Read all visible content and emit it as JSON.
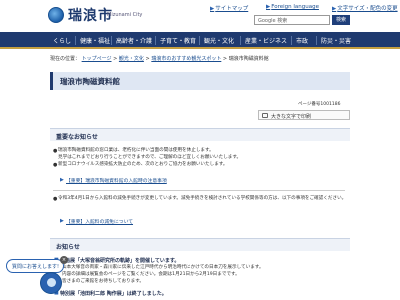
{
  "header": {
    "logo_text": "瑞浪市",
    "logo_sub": "Mizunami City",
    "links": [
      {
        "label": "サイトマップ"
      },
      {
        "label": "Foreign language"
      },
      {
        "label": "文字サイズ・配色の変更"
      }
    ],
    "search_placeholder": "Google 検索",
    "search_button": "検索"
  },
  "gnav": [
    "くらし",
    "健康・福祉",
    "高齢者・介護",
    "子育て・教育",
    "観光・文化",
    "産業・ビジネス",
    "市政",
    "防災・災害"
  ],
  "breadcrumb": {
    "prefix": "現在の位置：",
    "items": [
      "トップページ",
      "観光・文化",
      "瑞浪市のおすすめ観光スポット",
      "瑞浪市陶磁資料館"
    ]
  },
  "page": {
    "title": "瑞浪市陶磁資料館",
    "page_id": "ページ番号1001186",
    "font_size_label": "大きな文字で印刷"
  },
  "notice": {
    "heading": "重要なお知らせ",
    "p1": "瑞浪市陶磁資料館の窓ロ業は、老朽化に伴い当面の間は使用を休止します。",
    "p1b": "見学はこれまでどおり行うことができますので、ご理解のほど宜しくお願いいたします。",
    "p2": "新型コロナウイルス感染拡大防止のため、次のとおりご協力をお願いいたします。",
    "link1": "【重要】瑞浪市陶磁資料館の入館時の注意事項",
    "p3": "令和3年4月1日から入館料の減免手続きが変更しています。減免手続きを検討されている学校関係等の方は、以下の事項をご確認ください。",
    "link2": "【重要】入館料の減免について"
  },
  "news": {
    "heading": "お知らせ",
    "items": [
      {
        "title": "企画展「大塚音翁研究所の軌跡」を開催しています。"
      },
      {
        "title": "特別展「池田利二郎 陶作展」は終了しました。"
      }
    ],
    "text1": "山本大塚音の両家・森川家に伝来した江戸時代から明治時代にかけての日本刀を展示しています。",
    "text2": "内容の詳細は展覧会のページをご覧ください。会期は1月21日から2月19日までです。",
    "text3": "皆さまのご来館をお待ちしております。"
  },
  "chat": {
    "bubble": "質問にお答えします!",
    "close": "×"
  }
}
